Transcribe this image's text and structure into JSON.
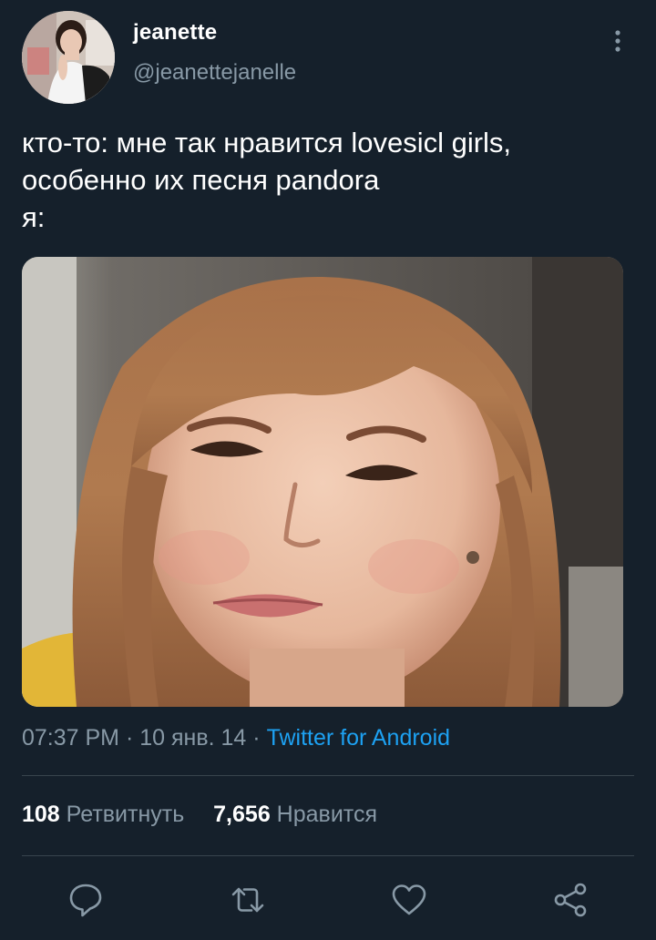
{
  "author": {
    "display_name": "jeanette",
    "handle": "@jeanettejanelle"
  },
  "tweet": {
    "lines": [
      "кто-то: мне так нравится lovesicl girls,",
      "особенно их песня pandora",
      "я:"
    ]
  },
  "meta": {
    "time": "07:37 PM",
    "sep1": "·",
    "date": "10 янв. 14",
    "sep2": "·",
    "source": "Twitter for Android"
  },
  "stats": {
    "retweets_count": "108",
    "retweets_label": "Ретвитнуть",
    "likes_count": "7,656",
    "likes_label": "Нравится"
  },
  "icons": {
    "more": "more-vertical-icon",
    "reply": "reply-icon",
    "retweet": "retweet-icon",
    "like": "heart-icon",
    "share": "share-icon"
  },
  "colors": {
    "background": "#15202b",
    "secondary_text": "#8899a6",
    "link": "#1da1f2",
    "divider": "#38444d"
  }
}
